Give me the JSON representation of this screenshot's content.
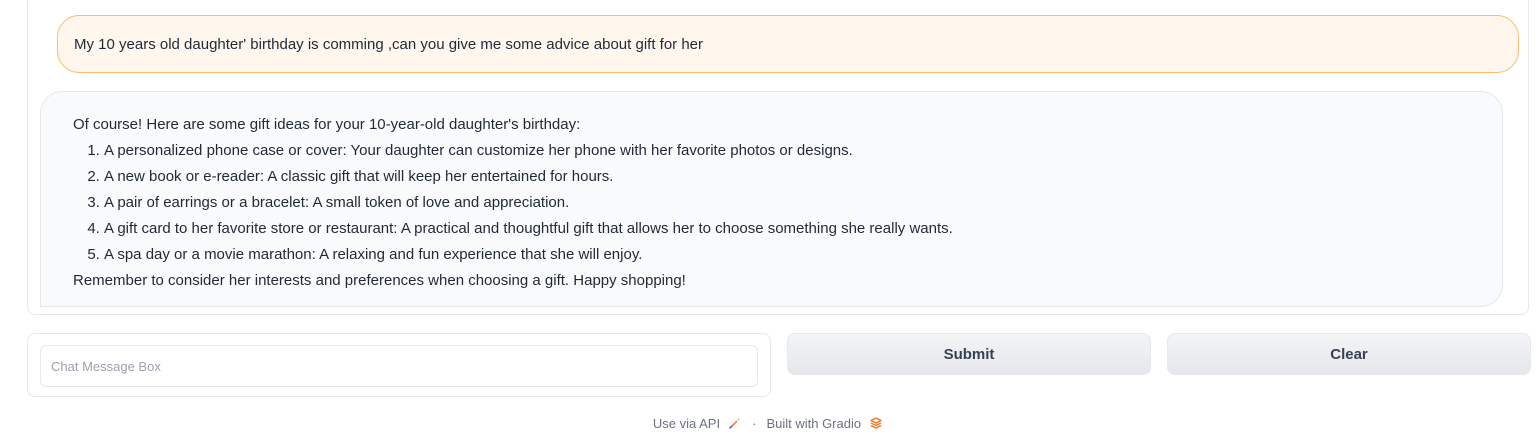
{
  "chat": {
    "user_message": "My 10 years old daughter' birthday is comming ,can you give me some advice about gift for her",
    "bot_intro": "Of course! Here are some gift ideas for your 10-year-old daughter's birthday:",
    "bot_list": [
      "A personalized phone case or cover: Your daughter can customize her phone with her favorite photos or designs.",
      "A new book or e-reader: A classic gift that will keep her entertained for hours.",
      "A pair of earrings or a bracelet: A small token of love and appreciation.",
      "A gift card to her favorite store or restaurant: A practical and thoughtful gift that allows her to choose something she really wants.",
      "A spa day or a movie marathon: A relaxing and fun experience that she will enjoy."
    ],
    "bot_outro": "Remember to consider her interests and preferences when choosing a gift. Happy shopping!"
  },
  "input": {
    "placeholder": "Chat Message Box",
    "value": ""
  },
  "buttons": {
    "submit": "Submit",
    "clear": "Clear"
  },
  "footer": {
    "api_link": "Use via API",
    "separator": "·",
    "built_with": "Built with Gradio",
    "api_icon": "rocket-icon",
    "gradio_icon": "gradio-logo-icon"
  },
  "colors": {
    "user_bubble_bg": "#fff7ed",
    "user_bubble_border": "#fdba74",
    "bot_bubble_bg": "#f9fafb",
    "accent_orange": "#f97316"
  }
}
